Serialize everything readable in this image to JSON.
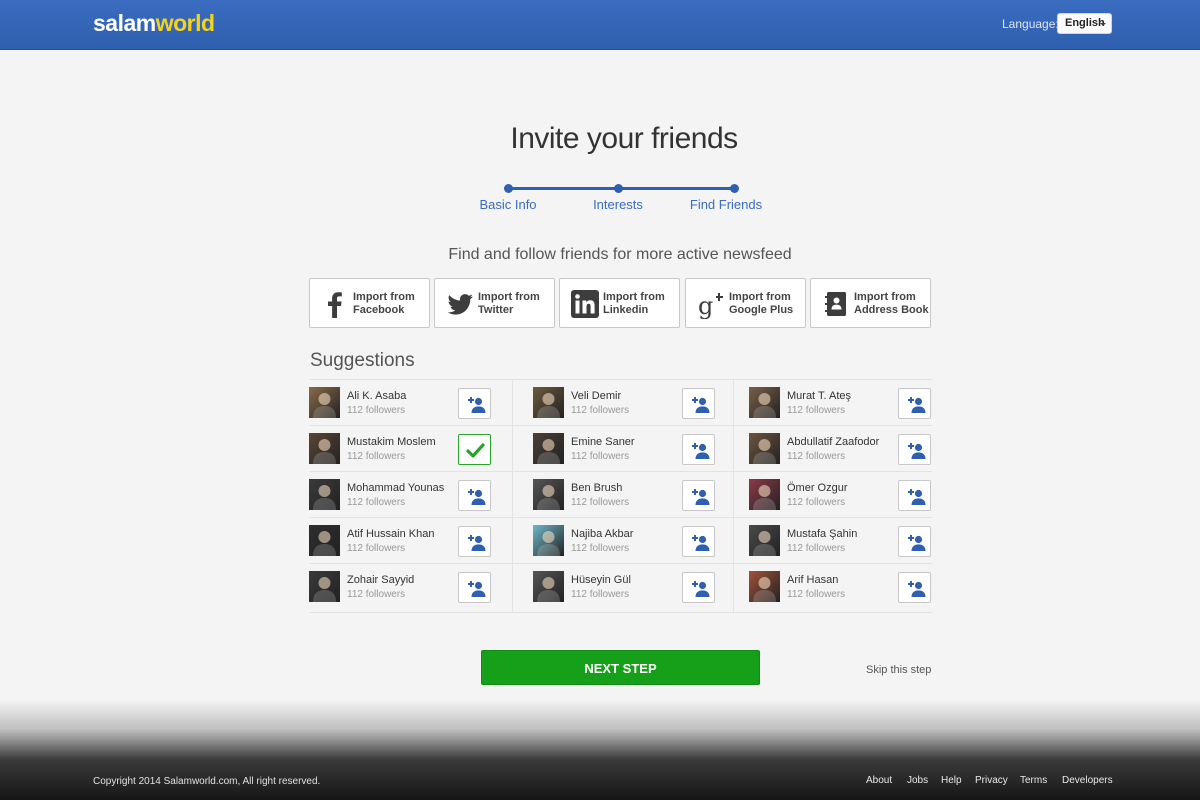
{
  "header": {
    "logo_part1": "salam",
    "logo_part2": "world",
    "language_label": "Language:",
    "language_value": "English"
  },
  "page": {
    "title": "Invite your friends",
    "subtitle": "Find and follow friends for more active newsfeed",
    "suggestions_title": "Suggestions"
  },
  "steps": [
    {
      "label": "Basic Info"
    },
    {
      "label": "Interests"
    },
    {
      "label": "Find Friends"
    }
  ],
  "imports": [
    {
      "line1": "Import from",
      "line2": "Facebook",
      "icon": "facebook-icon"
    },
    {
      "line1": "Import from",
      "line2": "Twitter",
      "icon": "twitter-icon"
    },
    {
      "line1": "Import from",
      "line2": "Linkedin",
      "icon": "linkedin-icon"
    },
    {
      "line1": "Import from",
      "line2": "Google Plus",
      "icon": "google-plus-icon"
    },
    {
      "line1": "Import from",
      "line2": "Address Book",
      "icon": "address-book-icon"
    }
  ],
  "people": [
    {
      "name": "Ali K. Asaba",
      "followers": "112 followers",
      "followed": false
    },
    {
      "name": "Veli Demir",
      "followers": "112 followers",
      "followed": false
    },
    {
      "name": "Murat T. Ateş",
      "followers": "112 followers",
      "followed": false
    },
    {
      "name": "Mustakim Moslem",
      "followers": "112 followers",
      "followed": true
    },
    {
      "name": "Emine Saner",
      "followers": "112 followers",
      "followed": false
    },
    {
      "name": "Abdullatif Zaafodor",
      "followers": "112 followers",
      "followed": false
    },
    {
      "name": "Mohammad Younas",
      "followers": "112 followers",
      "followed": false
    },
    {
      "name": "Ben Brush",
      "followers": "112 followers",
      "followed": false
    },
    {
      "name": "Ömer Ozgur",
      "followers": "112 followers",
      "followed": false
    },
    {
      "name": "Atif Hussain Khan",
      "followers": "112 followers",
      "followed": false
    },
    {
      "name": "Najiba Akbar",
      "followers": "112 followers",
      "followed": false
    },
    {
      "name": "Mustafa Şahin",
      "followers": "112 followers",
      "followed": false
    },
    {
      "name": "Zohair Sayyid",
      "followers": "112 followers",
      "followed": false
    },
    {
      "name": "Hüseyin Gül",
      "followers": "112 followers",
      "followed": false
    },
    {
      "name": "Arif Hasan",
      "followers": "112 followers",
      "followed": false
    }
  ],
  "actions": {
    "next_label": "NEXT STEP",
    "skip_label": "Skip this step"
  },
  "footer": {
    "copyright": "Copyright 2014 Salamworld.com, All right reserved.",
    "links": [
      "About",
      "Jobs",
      "Help",
      "Privacy",
      "Terms",
      "Developers"
    ]
  },
  "colors": {
    "brand_blue": "#2f5fae",
    "logo_yellow": "#f5d31c",
    "accent_green": "#16a019"
  }
}
